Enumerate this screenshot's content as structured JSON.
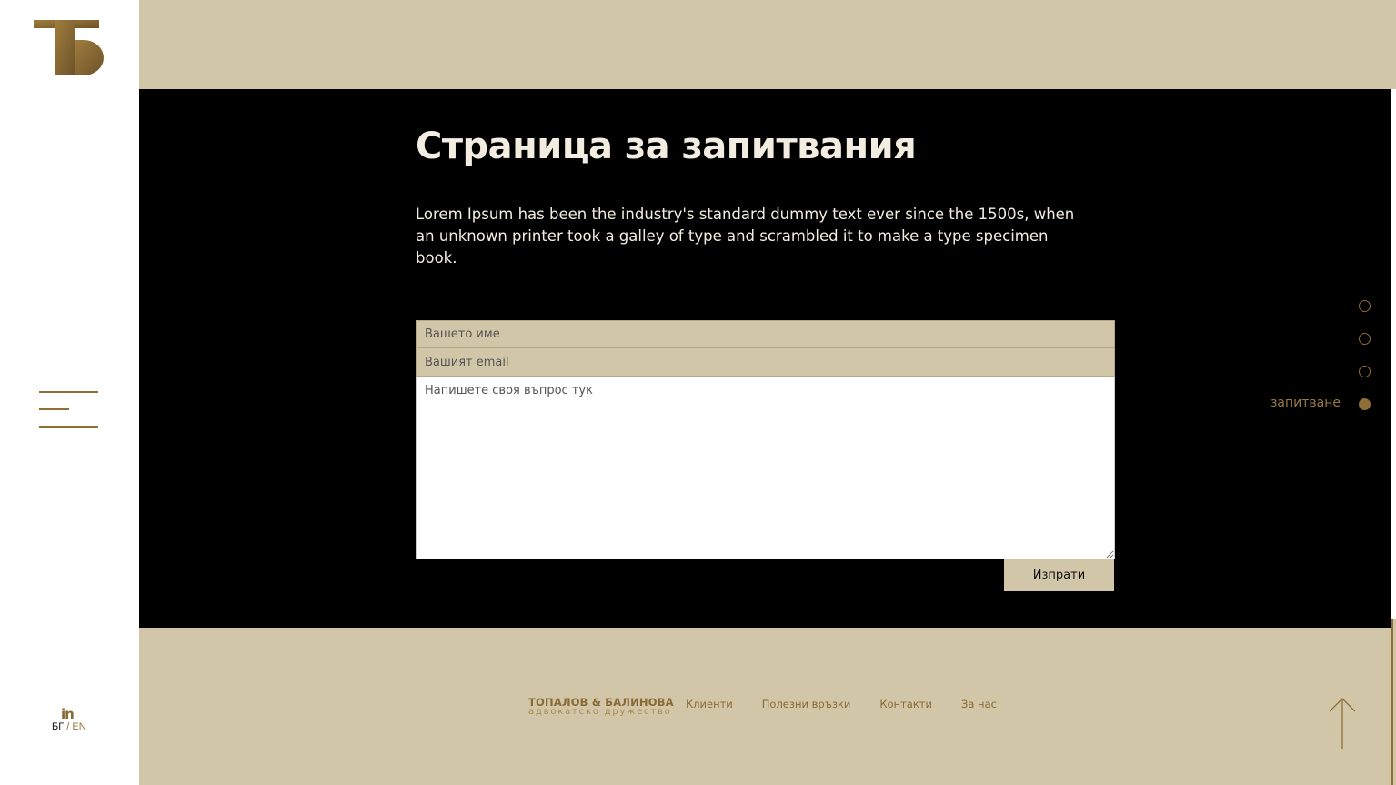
{
  "colors": {
    "beige": "#d1c6a7",
    "gold": "#8f6f38",
    "hero_bg": "#000000",
    "hero_text": "#f3ede1"
  },
  "sidebar": {
    "logo_icon": "tb-monogram-icon",
    "menu_icon": "hamburger-menu-icon",
    "social_icon": "linkedin-icon",
    "social_text": "in",
    "lang": {
      "active": "БГ",
      "separator": "/",
      "other": "EN"
    }
  },
  "hero": {
    "title": "Страница за запитвания",
    "intro": "Lorem Ipsum has been the industry's standard dummy text ever since the 1500s, when an unknown printer took a galley of type and scrambled it to make a type specimen book."
  },
  "form": {
    "name_placeholder": "Вашето име",
    "email_placeholder": "Вашият email",
    "question_placeholder": "Напишете своя въпрос тук",
    "submit_label": "Изпрати"
  },
  "section_nav": {
    "dots": 4,
    "active_index": 3,
    "active_label": "запитване"
  },
  "footer": {
    "brand_name": "ТОПАЛОВ & БАЛИНОВА",
    "brand_sub": "адвокатско дружество",
    "links": [
      "Клиенти",
      "Полезни връзки",
      "Контакти",
      "За нас"
    ],
    "back_to_top_icon": "arrow-up-icon"
  }
}
